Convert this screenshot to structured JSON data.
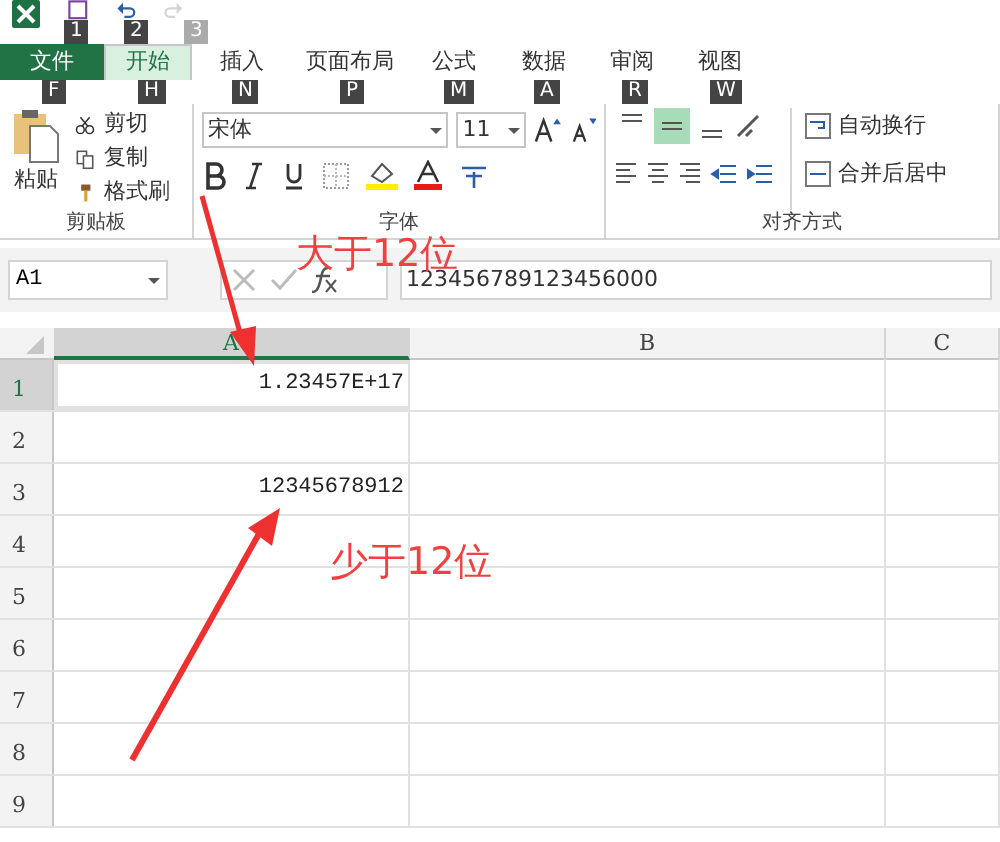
{
  "quick_access": [
    {
      "kind": "save",
      "key_tip": "1",
      "disabled": false
    },
    {
      "kind": "undo",
      "key_tip": "2",
      "disabled": false
    },
    {
      "kind": "redo",
      "key_tip": "3",
      "disabled": true
    }
  ],
  "tabs": [
    {
      "label": "文件",
      "key_tip": "F",
      "kind": "file",
      "selected": false
    },
    {
      "label": "开始",
      "key_tip": "H",
      "kind": "tab",
      "selected": true
    },
    {
      "label": "插入",
      "key_tip": "N",
      "kind": "tab",
      "selected": false
    },
    {
      "label": "页面布局",
      "key_tip": "P",
      "kind": "tab",
      "selected": false
    },
    {
      "label": "公式",
      "key_tip": "M",
      "kind": "tab",
      "selected": false
    },
    {
      "label": "数据",
      "key_tip": "A",
      "kind": "tab",
      "selected": false
    },
    {
      "label": "审阅",
      "key_tip": "R",
      "kind": "tab",
      "selected": false
    },
    {
      "label": "视图",
      "key_tip": "W",
      "kind": "tab",
      "selected": false
    }
  ],
  "clipboard": {
    "label": "剪贴板",
    "paste": "粘贴",
    "items": [
      {
        "kind": "cut",
        "label": "剪切"
      },
      {
        "kind": "copy",
        "label": "复制"
      },
      {
        "kind": "painter",
        "label": "格式刷"
      }
    ]
  },
  "font": {
    "label": "字体",
    "font_name": "宋体",
    "font_size": "11"
  },
  "alignment": {
    "label": "对齐方式",
    "vertical": [
      {
        "selected": false
      },
      {
        "selected": true
      },
      {
        "selected": false
      }
    ],
    "wrap": "自动换行",
    "merge": "合并后居中"
  },
  "formula_bar": {
    "name_box": "A1",
    "formula": "123456789123456000"
  },
  "columns": [
    {
      "header": "A",
      "selected": true
    },
    {
      "header": "B",
      "selected": false
    },
    {
      "header": "C",
      "selected": false
    }
  ],
  "rows": [
    {
      "header": "1",
      "value": "1.23457E+17",
      "selected": true
    },
    {
      "header": "2",
      "value": "",
      "selected": false
    },
    {
      "header": "3",
      "value": "12345678912",
      "selected": false
    },
    {
      "header": "4",
      "selected": false
    },
    {
      "header": "5",
      "selected": false
    },
    {
      "header": "6",
      "selected": false
    },
    {
      "header": "7",
      "selected": false
    },
    {
      "header": "8",
      "selected": false
    },
    {
      "header": "9",
      "selected": false
    }
  ],
  "annotations": [
    {
      "text": "大于12位"
    },
    {
      "text": "少于12位"
    }
  ]
}
